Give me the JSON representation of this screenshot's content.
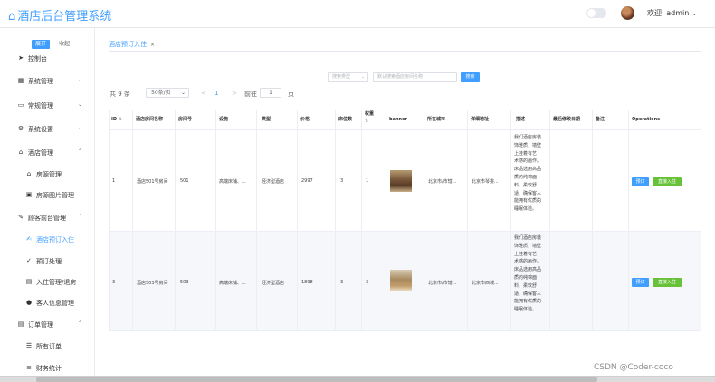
{
  "header": {
    "logo": "酒店后台管理系统",
    "user_label": "欢迎: admin"
  },
  "sidebar": {
    "expand_label": "展开",
    "collapse_label": "收起",
    "items": [
      {
        "label": "控制台",
        "icon": "send-icon"
      },
      {
        "label": "系统管理",
        "icon": "grid-icon"
      },
      {
        "label": "常规管理",
        "icon": "monitor-icon"
      },
      {
        "label": "系统设置",
        "icon": "gear-icon"
      },
      {
        "label": "酒店管理",
        "icon": "home-icon"
      },
      {
        "label": "房源管理",
        "icon": "house-icon"
      },
      {
        "label": "房源图片管理",
        "icon": "image-icon"
      },
      {
        "label": "顾客前台管理",
        "icon": "edit-icon"
      },
      {
        "label": "酒店预订入住",
        "icon": "edit-square-icon"
      },
      {
        "label": "预订处理",
        "icon": "check-icon"
      },
      {
        "label": "入住管理/退房",
        "icon": "document-icon"
      },
      {
        "label": "客人信息管理",
        "icon": "person-icon"
      },
      {
        "label": "订单管理",
        "icon": "order-icon"
      },
      {
        "label": "所有订单",
        "icon": "list-icon"
      },
      {
        "label": "财务统计",
        "icon": "database-icon"
      }
    ]
  },
  "tabs": [
    {
      "label": "酒店预订入住"
    }
  ],
  "search": {
    "type_placeholder": "搜索类型",
    "keyword_placeholder": "默认搜索酒店房间名称",
    "button_label": "搜索"
  },
  "pagination": {
    "total": "共 9 条",
    "page_size": "50条/页",
    "prev": "<",
    "current": "1",
    "next": ">",
    "goto": "前往",
    "page_input": "1",
    "page_unit": "页"
  },
  "table": {
    "columns": [
      "ID",
      "酒店房间名称",
      "房间号",
      "设施",
      "类型",
      "价格",
      "床位数",
      "权重",
      "banner",
      "所在城市",
      "详细地址",
      "描述",
      "最后修改日期",
      "备注",
      "Operations"
    ],
    "rows": [
      {
        "id": "1",
        "name": "酒店501号房间",
        "room": "501",
        "facility": "高端床铺、...",
        "type": "经济型酒店",
        "price": "2997",
        "beds": "3",
        "weight": "1",
        "city": "北京市/市辖...",
        "address": "北京市琴委...",
        "desc": [
          "我们酒店房装",
          "饰雅质，墙壁",
          "上挂着有艺",
          "术感的画作。",
          "床品选用高品",
          "质的纯棉面",
          "料，柔软舒",
          "适，确保客人",
          "能拥有优质的",
          "睡眠体验。"
        ],
        "btn_reserve": "预订",
        "btn_checkin": "直接入住"
      },
      {
        "id": "3",
        "name": "酒店503号房间",
        "room": "503",
        "facility": "高端床铺、...",
        "type": "经济型酒店",
        "price": "1898",
        "beds": "3",
        "weight": "3",
        "city": "北京市/市辖...",
        "address": "北京市西城...",
        "desc": [
          "我们酒店房装",
          "饰雅质，墙壁",
          "上挂着有艺",
          "术感的画作。",
          "床品选用高品",
          "质的纯棉面",
          "料，柔软舒",
          "适，确保客人",
          "能拥有优质的",
          "睡眠体验。"
        ],
        "btn_reserve": "预订",
        "btn_checkin": "直接入住"
      }
    ]
  },
  "watermark": "CSDN @Coder-coco",
  "colors": {
    "primary": "#409eff",
    "success": "#67c23a"
  }
}
